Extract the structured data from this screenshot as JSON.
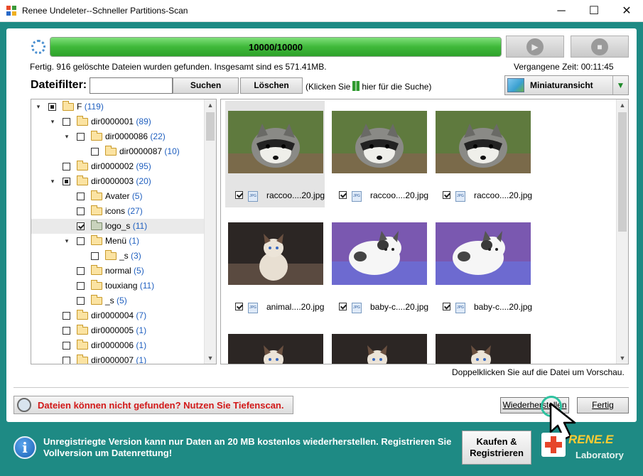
{
  "window": {
    "title": "Renee Undeleter--Schneller Partitions-Scan",
    "minimize_glyph": "─",
    "maximize_glyph": "☐",
    "close_glyph": "✕"
  },
  "scan": {
    "progress_text": "10000/10000",
    "progress_fraction": 1.0,
    "status": "Fertig. 916 gelöschte Dateien wurden gefunden. Insgesamt sind es 571.41MB.",
    "elapsed": "Vergangene Zeit: 00:11:45",
    "play_icon": "play-icon",
    "stop_icon": "stop-icon"
  },
  "filter": {
    "label": "Dateifilter:",
    "value": "",
    "search_label": "Suchen",
    "clear_label": "Löschen",
    "hint_before": "(Klicken Sie",
    "hint_after": "hier für die Suche)"
  },
  "view": {
    "label": "Miniaturansicht",
    "arrow": "▼"
  },
  "tree": [
    {
      "name": "F",
      "count": "(119)",
      "state": "partial",
      "toggle": "▾",
      "folder": "yellow"
    },
    {
      "name": "dir0000001",
      "count": "(89)",
      "state": "none",
      "toggle": "▾",
      "folder": "yellow"
    },
    {
      "name": "dir0000086",
      "count": "(22)",
      "state": "none",
      "toggle": "▾",
      "folder": "yellow"
    },
    {
      "name": "dir0000087",
      "count": "(10)",
      "state": "none",
      "toggle": "",
      "folder": "yellow"
    },
    {
      "name": "dir0000002",
      "count": "(95)",
      "state": "none",
      "toggle": "",
      "folder": "yellow"
    },
    {
      "name": "dir0000003",
      "count": "(20)",
      "state": "partial",
      "toggle": "▾",
      "folder": "yellow"
    },
    {
      "name": "Avater",
      "count": "(5)",
      "state": "none",
      "toggle": "",
      "folder": "yellow"
    },
    {
      "name": "icons",
      "count": "(27)",
      "state": "none",
      "toggle": "",
      "folder": "yellow"
    },
    {
      "name": "logo_s",
      "count": "(11)",
      "state": "checked",
      "toggle": "",
      "folder": "grey",
      "selected": true
    },
    {
      "name": "Menü",
      "count": "(1)",
      "state": "none",
      "toggle": "▾",
      "folder": "yellow"
    },
    {
      "name": "_s",
      "count": "(3)",
      "state": "none",
      "toggle": "",
      "folder": "yellow"
    },
    {
      "name": "normal",
      "count": "(5)",
      "state": "none",
      "toggle": "",
      "folder": "yellow"
    },
    {
      "name": "touxiang",
      "count": "(11)",
      "state": "none",
      "toggle": "",
      "folder": "yellow"
    },
    {
      "name": "_s",
      "count": "(5)",
      "state": "none",
      "toggle": "",
      "folder": "yellow"
    },
    {
      "name": "dir0000004",
      "count": "(7)",
      "state": "none",
      "toggle": "",
      "folder": "yellow"
    },
    {
      "name": "dir0000005",
      "count": "(1)",
      "state": "none",
      "toggle": "",
      "folder": "yellow"
    },
    {
      "name": "dir0000006",
      "count": "(1)",
      "state": "none",
      "toggle": "",
      "folder": "yellow"
    },
    {
      "name": "dir0000007",
      "count": "(1)",
      "state": "none",
      "toggle": "",
      "folder": "yellow"
    }
  ],
  "thumbnails": [
    {
      "name": "raccoo....20.jpg",
      "checked": true,
      "image": "raccoon-photo",
      "selected": true
    },
    {
      "name": "raccoo....20.jpg",
      "checked": true,
      "image": "raccoon-photo"
    },
    {
      "name": "raccoo....20.jpg",
      "checked": true,
      "image": "raccoon-photo"
    },
    {
      "name": "animal....20.jpg",
      "checked": true,
      "image": "cat-photo"
    },
    {
      "name": "baby-c....20.jpg",
      "checked": true,
      "image": "kitten-photo"
    },
    {
      "name": "baby-c....20.jpg",
      "checked": true,
      "image": "kitten-photo"
    },
    {
      "name": "",
      "checked": false,
      "image": "cat-photo"
    },
    {
      "name": "",
      "checked": false,
      "image": "cat-photo"
    },
    {
      "name": "",
      "checked": false,
      "image": "cat-photo"
    }
  ],
  "preview_hint": "Doppelklicken Sie auf die Datei um Vorschau.",
  "deepscan": "Dateien können nicht gefunden? Nutzen Sie Tiefenscan.",
  "actions": {
    "recover_label": "Wiederherstellen",
    "done_label": "Fertig"
  },
  "footer": {
    "notice": "Unregistriegte Version kann nur Daten an 20 MB kostenlos wiederherstellen. Registrieren Sie Vollversion um Datenrettung!",
    "buy_line1": "Kaufen &",
    "buy_line2": "Registrieren",
    "logo_name": "RENE.E",
    "logo_sub": "Laboratory",
    "info_glyph": "i"
  },
  "colors": {
    "background": "#1e8a84",
    "progress_fill": "#3fb83a",
    "count_blue": "#1f5fbf",
    "deepscan_red": "#d21919",
    "logo_orange": "#ffcc33"
  }
}
